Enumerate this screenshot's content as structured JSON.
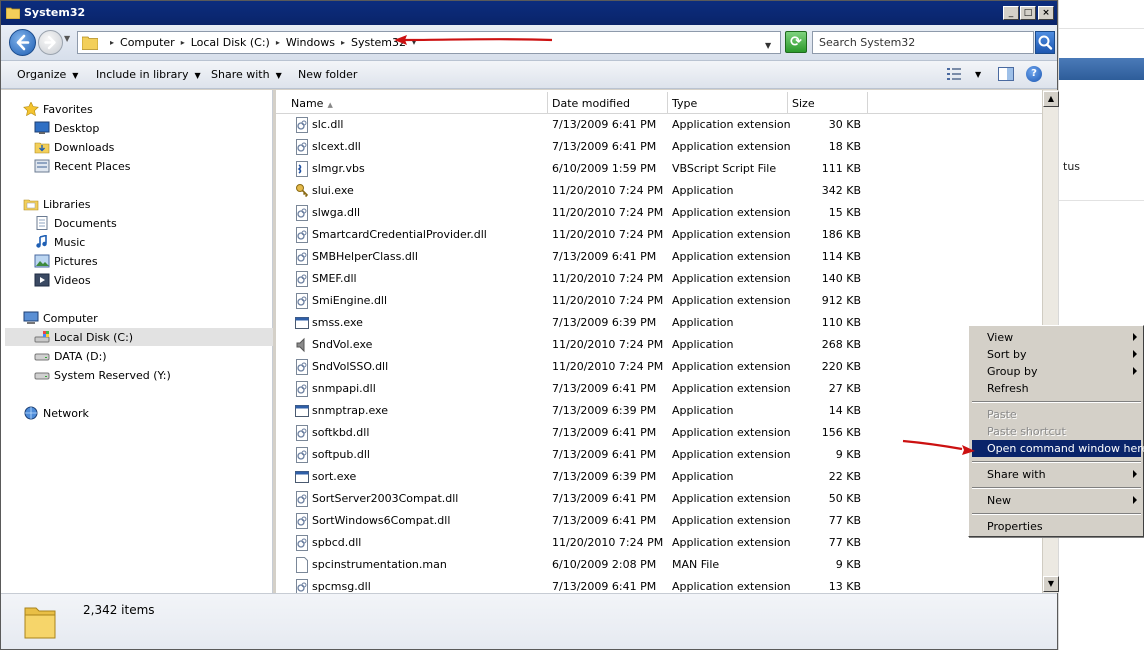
{
  "window": {
    "title": "System32",
    "min_label": "_",
    "max_label": "□",
    "close_label": "×"
  },
  "address": {
    "crumbs": [
      "Computer",
      "Local Disk (C:)",
      "Windows",
      "System32"
    ],
    "search_placeholder": "Search System32"
  },
  "toolbar": {
    "organize": "Organize",
    "include_in_library": "Include in library",
    "share_with": "Share with",
    "new_folder": "New folder",
    "help": "?"
  },
  "nav": {
    "favorites": {
      "label": "Favorites",
      "items": [
        "Desktop",
        "Downloads",
        "Recent Places"
      ]
    },
    "libraries": {
      "label": "Libraries",
      "items": [
        "Documents",
        "Music",
        "Pictures",
        "Videos"
      ]
    },
    "computer": {
      "label": "Computer",
      "items": [
        "Local Disk (C:)",
        "DATA (D:)",
        "System Reserved (Y:)"
      ]
    },
    "network": {
      "label": "Network"
    }
  },
  "columns": {
    "name": "Name",
    "date": "Date modified",
    "type": "Type",
    "size": "Size"
  },
  "files": [
    {
      "name": "slc.dll",
      "date": "7/13/2009 6:41 PM",
      "type": "Application extension",
      "size": "30 KB",
      "icon": "dll-icon"
    },
    {
      "name": "slcext.dll",
      "date": "7/13/2009 6:41 PM",
      "type": "Application extension",
      "size": "18 KB",
      "icon": "dll-icon"
    },
    {
      "name": "slmgr.vbs",
      "date": "6/10/2009 1:59 PM",
      "type": "VBScript Script File",
      "size": "111 KB",
      "icon": "script-icon"
    },
    {
      "name": "slui.exe",
      "date": "11/20/2010 7:24 PM",
      "type": "Application",
      "size": "342 KB",
      "icon": "key-icon"
    },
    {
      "name": "slwga.dll",
      "date": "11/20/2010 7:24 PM",
      "type": "Application extension",
      "size": "15 KB",
      "icon": "dll-icon"
    },
    {
      "name": "SmartcardCredentialProvider.dll",
      "date": "11/20/2010 7:24 PM",
      "type": "Application extension",
      "size": "186 KB",
      "icon": "dll-icon"
    },
    {
      "name": "SMBHelperClass.dll",
      "date": "7/13/2009 6:41 PM",
      "type": "Application extension",
      "size": "114 KB",
      "icon": "dll-icon"
    },
    {
      "name": "SMEF.dll",
      "date": "11/20/2010 7:24 PM",
      "type": "Application extension",
      "size": "140 KB",
      "icon": "dll-icon"
    },
    {
      "name": "SmiEngine.dll",
      "date": "11/20/2010 7:24 PM",
      "type": "Application extension",
      "size": "912 KB",
      "icon": "dll-icon"
    },
    {
      "name": "smss.exe",
      "date": "7/13/2009 6:39 PM",
      "type": "Application",
      "size": "110 KB",
      "icon": "exe-icon"
    },
    {
      "name": "SndVol.exe",
      "date": "11/20/2010 7:24 PM",
      "type": "Application",
      "size": "268 KB",
      "icon": "speaker-icon"
    },
    {
      "name": "SndVolSSO.dll",
      "date": "11/20/2010 7:24 PM",
      "type": "Application extension",
      "size": "220 KB",
      "icon": "dll-icon"
    },
    {
      "name": "snmpapi.dll",
      "date": "7/13/2009 6:41 PM",
      "type": "Application extension",
      "size": "27 KB",
      "icon": "dll-icon"
    },
    {
      "name": "snmptrap.exe",
      "date": "7/13/2009 6:39 PM",
      "type": "Application",
      "size": "14 KB",
      "icon": "exe-icon"
    },
    {
      "name": "softkbd.dll",
      "date": "7/13/2009 6:41 PM",
      "type": "Application extension",
      "size": "156 KB",
      "icon": "dll-icon"
    },
    {
      "name": "softpub.dll",
      "date": "7/13/2009 6:41 PM",
      "type": "Application extension",
      "size": "9 KB",
      "icon": "dll-icon"
    },
    {
      "name": "sort.exe",
      "date": "7/13/2009 6:39 PM",
      "type": "Application",
      "size": "22 KB",
      "icon": "exe-icon"
    },
    {
      "name": "SortServer2003Compat.dll",
      "date": "7/13/2009 6:41 PM",
      "type": "Application extension",
      "size": "50 KB",
      "icon": "dll-icon"
    },
    {
      "name": "SortWindows6Compat.dll",
      "date": "7/13/2009 6:41 PM",
      "type": "Application extension",
      "size": "77 KB",
      "icon": "dll-icon"
    },
    {
      "name": "spbcd.dll",
      "date": "11/20/2010 7:24 PM",
      "type": "Application extension",
      "size": "77 KB",
      "icon": "dll-icon"
    },
    {
      "name": "spcinstrumentation.man",
      "date": "6/10/2009 2:08 PM",
      "type": "MAN File",
      "size": "9 KB",
      "icon": "file-icon"
    },
    {
      "name": "spcmsg.dll",
      "date": "7/13/2009 6:41 PM",
      "type": "Application extension",
      "size": "13 KB",
      "icon": "dll-icon"
    }
  ],
  "status": {
    "item_count": "2,342 items"
  },
  "context_menu": {
    "view": "View",
    "sort_by": "Sort by",
    "group_by": "Group by",
    "refresh": "Refresh",
    "paste": "Paste",
    "paste_shortcut": "Paste shortcut",
    "open_command_window": "Open command window here",
    "share_with": "Share with",
    "new": "New",
    "properties": "Properties"
  },
  "background_window": {
    "partial_text": "tus"
  },
  "colors": {
    "annotation_arrow": "#cc1111",
    "menu_highlight": "#0a246a",
    "title_bar": "#0a246a"
  }
}
